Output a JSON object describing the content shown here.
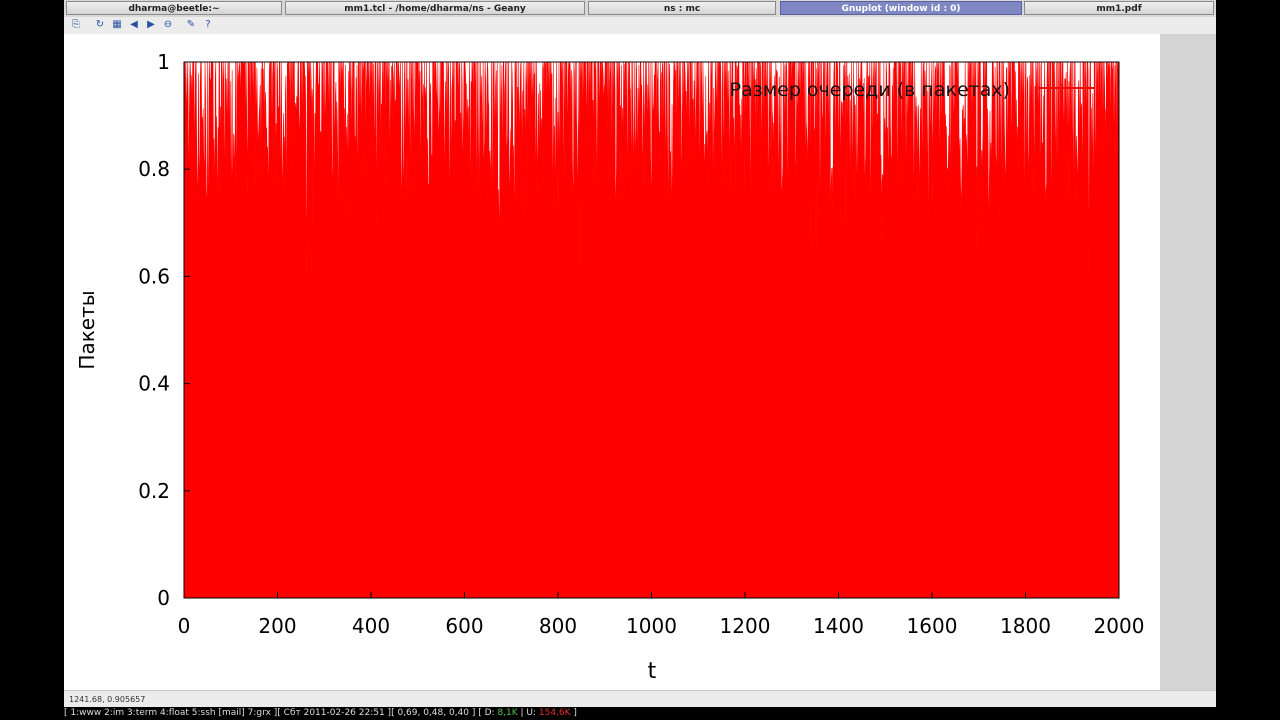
{
  "window_tabs": [
    {
      "label": "dharma@beetle:~",
      "active": false
    },
    {
      "label": "mm1.tcl - /home/dharma/ns - Geany",
      "active": false
    },
    {
      "label": "ns : mc",
      "active": false
    },
    {
      "label": "Gnuplot (window id : 0)",
      "active": true
    },
    {
      "label": "mm1.pdf",
      "active": false
    }
  ],
  "toolbar": {
    "icons": [
      "copy-icon",
      "replot-icon",
      "grid-icon",
      "zoom-previous-icon",
      "zoom-next-icon",
      "unzoom-icon",
      "config-icon",
      "help-icon"
    ],
    "glyphs": [
      "⎘",
      "↻",
      "▦",
      "◀",
      "▶",
      "⊖",
      "✎",
      "?"
    ]
  },
  "status": {
    "coords": "1241.68,  0.905657"
  },
  "bottombar": {
    "left": "[  1:www 2:im 3:term 4:float 5:ssh [mail] 7:grx ][ Сбт 2011-02-26 22:51 ][ 0,69, 0,48, 0,40 ] [ D: ",
    "download": "8,1K",
    "mid": " | U: ",
    "upload": "154,6K",
    "end": " ]"
  },
  "colors": {
    "series": "#ff0000",
    "active_tab": "#8088c4"
  },
  "chart_data": {
    "type": "area",
    "xlabel": "t",
    "ylabel": "Пакеты",
    "xlim": [
      0,
      2000
    ],
    "ylim": [
      0,
      1
    ],
    "xticks": [
      "0",
      "200",
      "400",
      "600",
      "800",
      "1000",
      "1200",
      "1400",
      "1600",
      "1800",
      "2000"
    ],
    "yticks": [
      "0",
      "0.2",
      "0.4",
      "0.6",
      "0.8",
      "1"
    ],
    "legend_position": "top-right",
    "series": [
      {
        "name": "Размер очереди (в пакетах)",
        "color": "#ff0000",
        "note_values_low_bound": 0.55,
        "x_step": 1,
        "values_sample": [
          0.7,
          0.95,
          1.0,
          0.88,
          0.98,
          1.0,
          0.85,
          0.97,
          1.0,
          0.92
        ]
      }
    ]
  }
}
